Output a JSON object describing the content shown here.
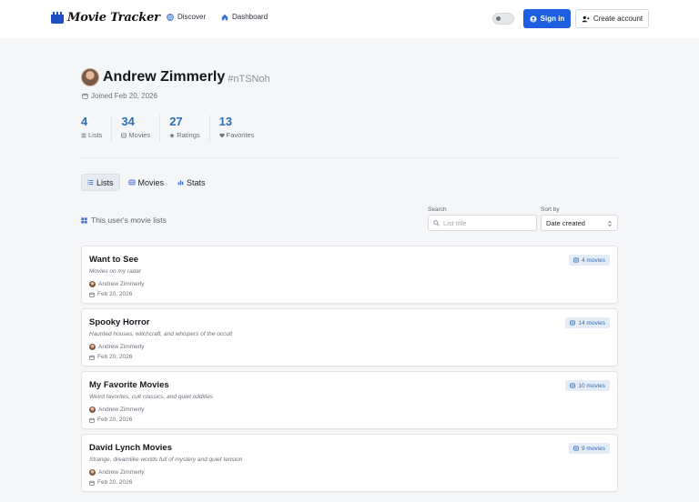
{
  "nav": {
    "brand": "Movie Tracker",
    "discover": "Discover",
    "dashboard": "Dashboard",
    "sign_in": "Sign in",
    "create_account": "Create account"
  },
  "profile": {
    "name": "Andrew Zimmerly",
    "handle": "#nTSNoh",
    "joined": "Joined Feb 20, 2026"
  },
  "stats": [
    {
      "value": "4",
      "label": "Lists",
      "icon": "list-icon"
    },
    {
      "value": "34",
      "label": "Movies",
      "icon": "film-icon"
    },
    {
      "value": "27",
      "label": "Ratings",
      "icon": "star-icon"
    },
    {
      "value": "13",
      "label": "Favorites",
      "icon": "heart-icon"
    }
  ],
  "tabs": [
    {
      "label": "Lists",
      "active": true
    },
    {
      "label": "Movies",
      "active": false
    },
    {
      "label": "Stats",
      "active": false
    }
  ],
  "section": {
    "title": "This user's movie lists"
  },
  "search": {
    "label": "Search",
    "placeholder": "List title"
  },
  "sort": {
    "label": "Sort by",
    "value": "Date created"
  },
  "lists": [
    {
      "title": "Want to See",
      "description": "Movies on my radar",
      "owner": "Andrew Zimmerly",
      "date": "Feb 20, 2026",
      "count": "4 movies"
    },
    {
      "title": "Spooky Horror",
      "description": "Haunted houses, witchcraft, and whispers of the occult",
      "owner": "Andrew Zimmerly",
      "date": "Feb 20, 2026",
      "count": "14 movies"
    },
    {
      "title": "My Favorite Movies",
      "description": "Weird favorites, cult classics, and quiet oddities",
      "owner": "Andrew Zimmerly",
      "date": "Feb 20, 2026",
      "count": "10 movies"
    },
    {
      "title": "David Lynch Movies",
      "description": "Strange, dreamlike worlds full of mystery and quiet tension",
      "owner": "Andrew Zimmerly",
      "date": "Feb 20, 2026",
      "count": "9 movies"
    }
  ],
  "colors": {
    "accent": "#1d5fe0",
    "stat": "#2f6db3",
    "badge_bg": "#e4ecf8"
  }
}
